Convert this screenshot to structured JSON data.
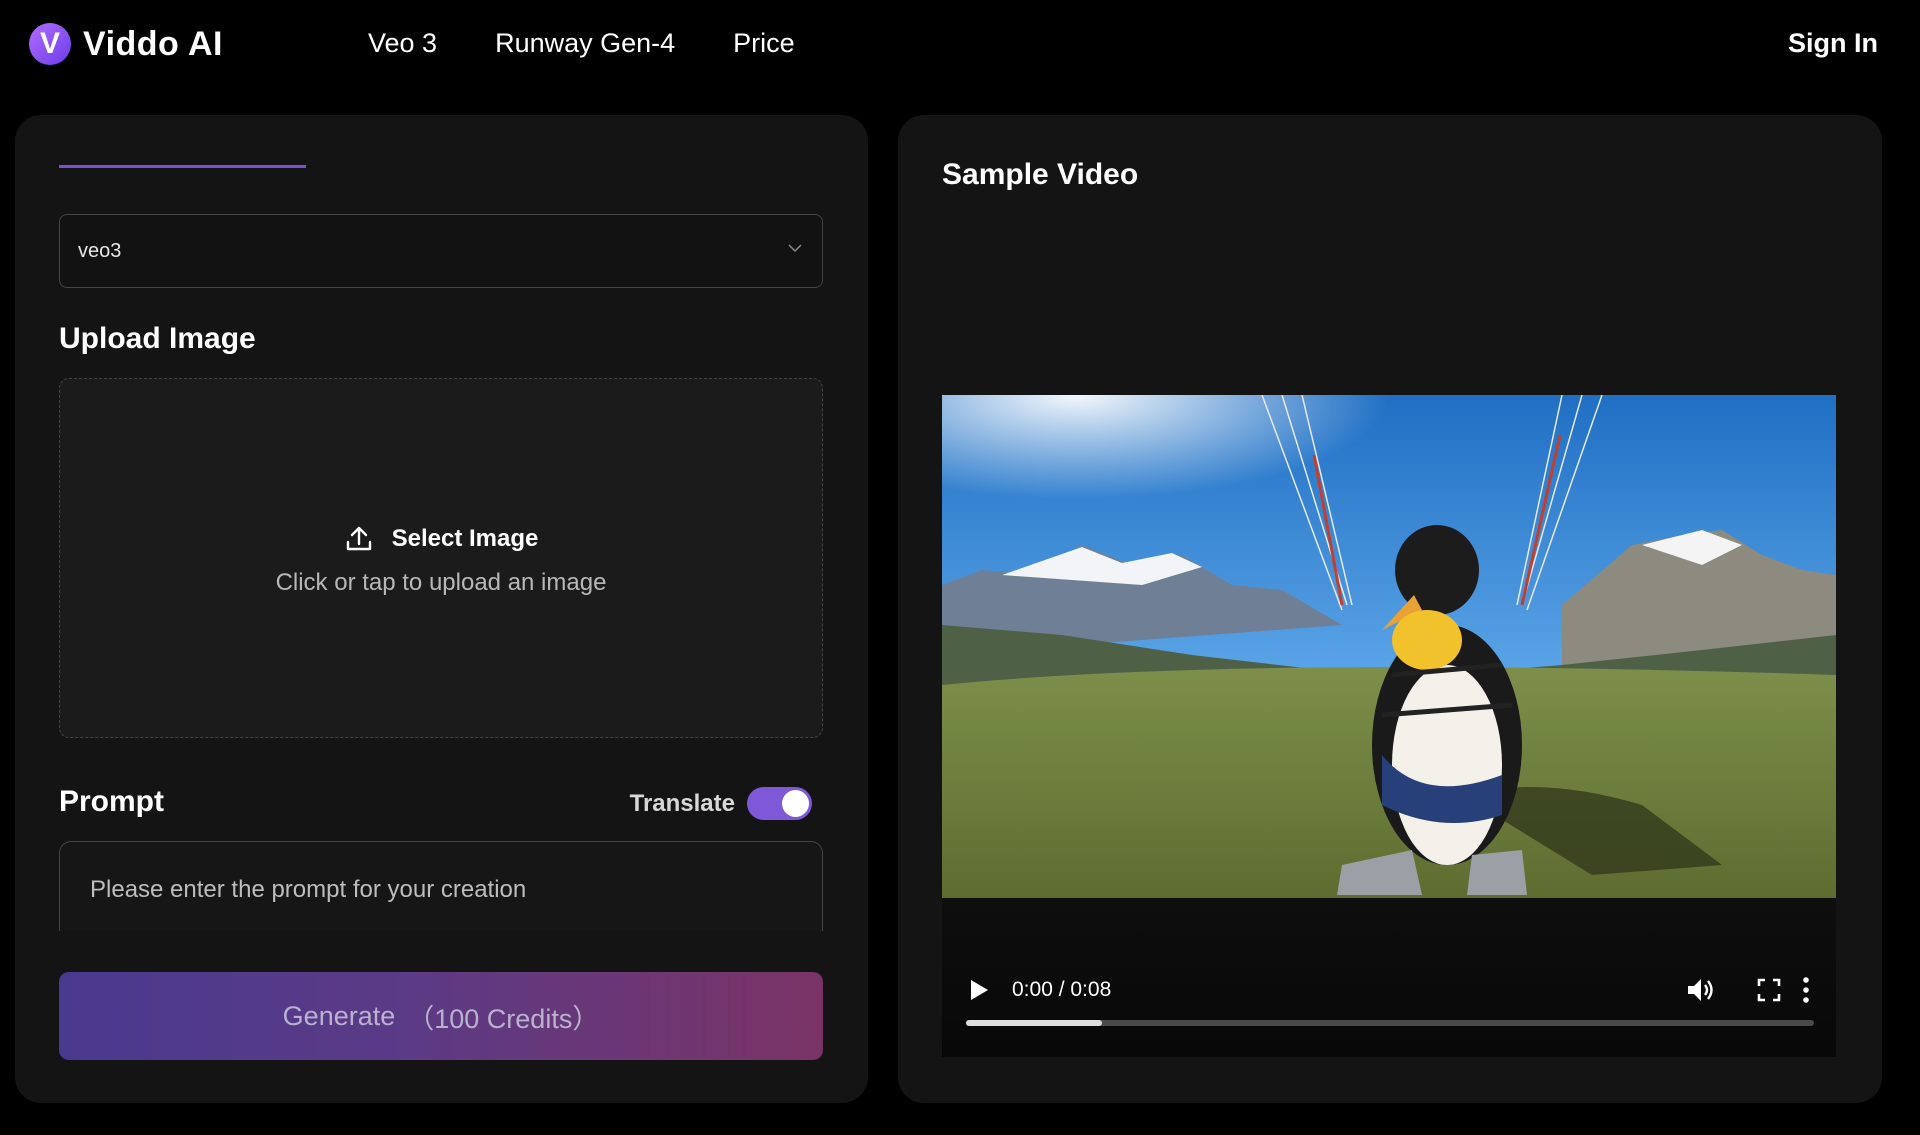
{
  "brand": {
    "logo_letter": "V",
    "name": "Viddo AI"
  },
  "nav": {
    "items": [
      "Veo 3",
      "Runway Gen-4",
      "Price"
    ],
    "signin": "Sign In"
  },
  "form": {
    "model_select": {
      "value": "veo3"
    },
    "upload": {
      "heading": "Upload Image",
      "button_label": "Select Image",
      "hint": "Click or tap to upload an image"
    },
    "prompt": {
      "heading": "Prompt",
      "translate_label": "Translate",
      "translate_on": true,
      "placeholder": "Please enter the prompt for your creation"
    },
    "generate": {
      "label": "Generate",
      "credits": "（100 Credits）"
    }
  },
  "sample": {
    "title": "Sample Video",
    "player": {
      "time": "0:00 / 0:08",
      "progress_fraction": 0.16
    }
  },
  "colors": {
    "accent": "#7b4fd6",
    "toggle": "#7f58d8",
    "generate_start": "#4a3a8f",
    "generate_end": "#7a3365"
  },
  "icons": [
    "chevron-down-icon",
    "upload-icon",
    "play-icon",
    "volume-icon",
    "fullscreen-icon",
    "more-vertical-icon"
  ]
}
